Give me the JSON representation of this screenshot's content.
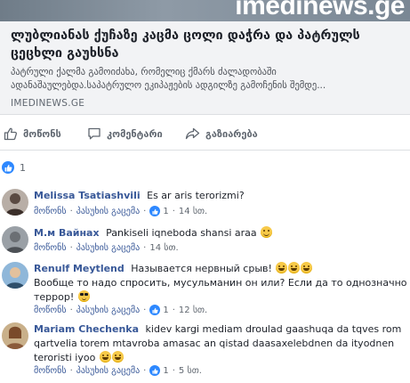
{
  "post": {
    "hero_logo": "imedinews.ge",
    "link_title": "ლუბლიანას ქუჩაზე კაცმა ცოლი დაჭრა და პატრულს ცეცხლი გაუხსნა",
    "link_description": "პატრული ქალმა გამოიძახა, რომელიც ქმარს ძალადობაში ადანაშაულებდა.საპატრულო ეკიპაჟების ადგილზე გამოჩენის შემდე...",
    "link_domain": "IMEDINEWS.GE"
  },
  "actions": {
    "like": "მოწონს",
    "comment": "კომენტარი",
    "share": "გაზიარება"
  },
  "reactions": {
    "count": "1"
  },
  "comment_actions": {
    "like": "მოწონს",
    "reply": "პასუხის გაცემა"
  },
  "comments": [
    {
      "name": "Melissa Tsatiashvili",
      "text": "Es ar aris terorizmi?",
      "likes": "1",
      "time": "14 სთ."
    },
    {
      "name": "М.м Вайнах",
      "text": "Pankiseli iqneboda shansi araa",
      "likes": "",
      "time": "14 სთ."
    },
    {
      "name": "Renulf Meytlend",
      "text": "Называется нервный срыв!",
      "text2": "Вообще то надо спросить, мусульманин он или? Если да то однозначно террор!",
      "likes": "1",
      "time": "12 სთ."
    },
    {
      "name": "Mariam Chechenka",
      "text": "kidev kargi mediam droulad gaashuqa da tqves rom qartvelia torem mtavroba amasac an qistad daasaxelebdnen da ityodnen teroristi iyoo",
      "likes": "1",
      "time": "5 სთ."
    }
  ],
  "colors": {
    "link": "#385898",
    "like_blue": "#2d88ff",
    "meta": "#606770",
    "card_bg": "#f2f3f5"
  }
}
